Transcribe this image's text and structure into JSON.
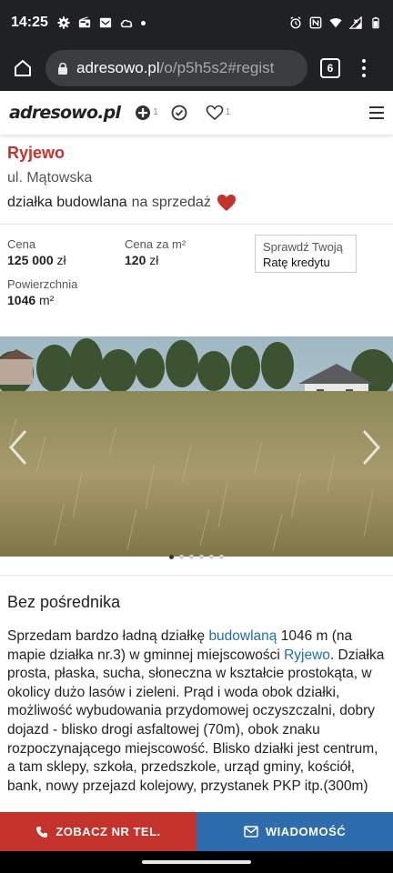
{
  "status_bar": {
    "time": "14:25",
    "left_icons": [
      "settings-icon",
      "radio-icon",
      "mail-icon",
      "cloud-icon",
      "dot"
    ],
    "right_icons": [
      "alarm-icon",
      "nfc-icon",
      "wifi-icon",
      "signal-icon",
      "battery-icon"
    ]
  },
  "browser": {
    "url_host": "adresowo.pl",
    "url_path": "/o/p5h5s2#regist",
    "tab_count": "6"
  },
  "site_header": {
    "logo": "adresowo.pl",
    "add_count": "1",
    "fav_count": "1"
  },
  "listing": {
    "city": "Ryjewo",
    "street": "ul. Mątowska",
    "type_bold": "działka budowlana",
    "type_rest": "na sprzedaż"
  },
  "prices": {
    "price_label": "Cena",
    "price_value": "125 000",
    "price_unit": "zł",
    "ppm_label": "Cena za m²",
    "ppm_value": "120",
    "ppm_unit": "zł",
    "area_label": "Powierzchnia",
    "area_value": "1046",
    "area_unit": "m²",
    "credit_line1": "Sprawdź Twoją",
    "credit_line2": "Ratę kredytu"
  },
  "gallery": {
    "slide_count": 6,
    "active_slide": 1
  },
  "description": {
    "title": "Bez pośrednika",
    "t1": "Sprzedam bardzo ładną działkę ",
    "link1": "budowlaną",
    "t2": " 1046 m (na mapie działka nr.3) w gminnej miejscowości ",
    "link2": "Ryjewo",
    "t3": ". Działka prosta, płaska, sucha, słoneczna w kształcie prostokąta, w okolicy dużo lasów i zieleni. Prąd i woda obok działki, możliwość wybudowania przydomowej oczyszczalni, dobry dojazd - blisko drogi asfaltowej (70m), obok znaku rozpoczynającego miejscowość. Blisko działki jest centrum, a tam sklepy, szkoła, przedszkole, urząd gminy, kościół, bank, nowy przejazd kolejowy, przystanek PKP itp.(300m)"
  },
  "actions": {
    "call_label": "ZOBACZ NR TEL.",
    "message_label": "WIADOMOŚĆ"
  },
  "colors": {
    "brand_red": "#c4332b",
    "brand_blue": "#2d6dae",
    "link_blue": "#1f6fa8"
  }
}
